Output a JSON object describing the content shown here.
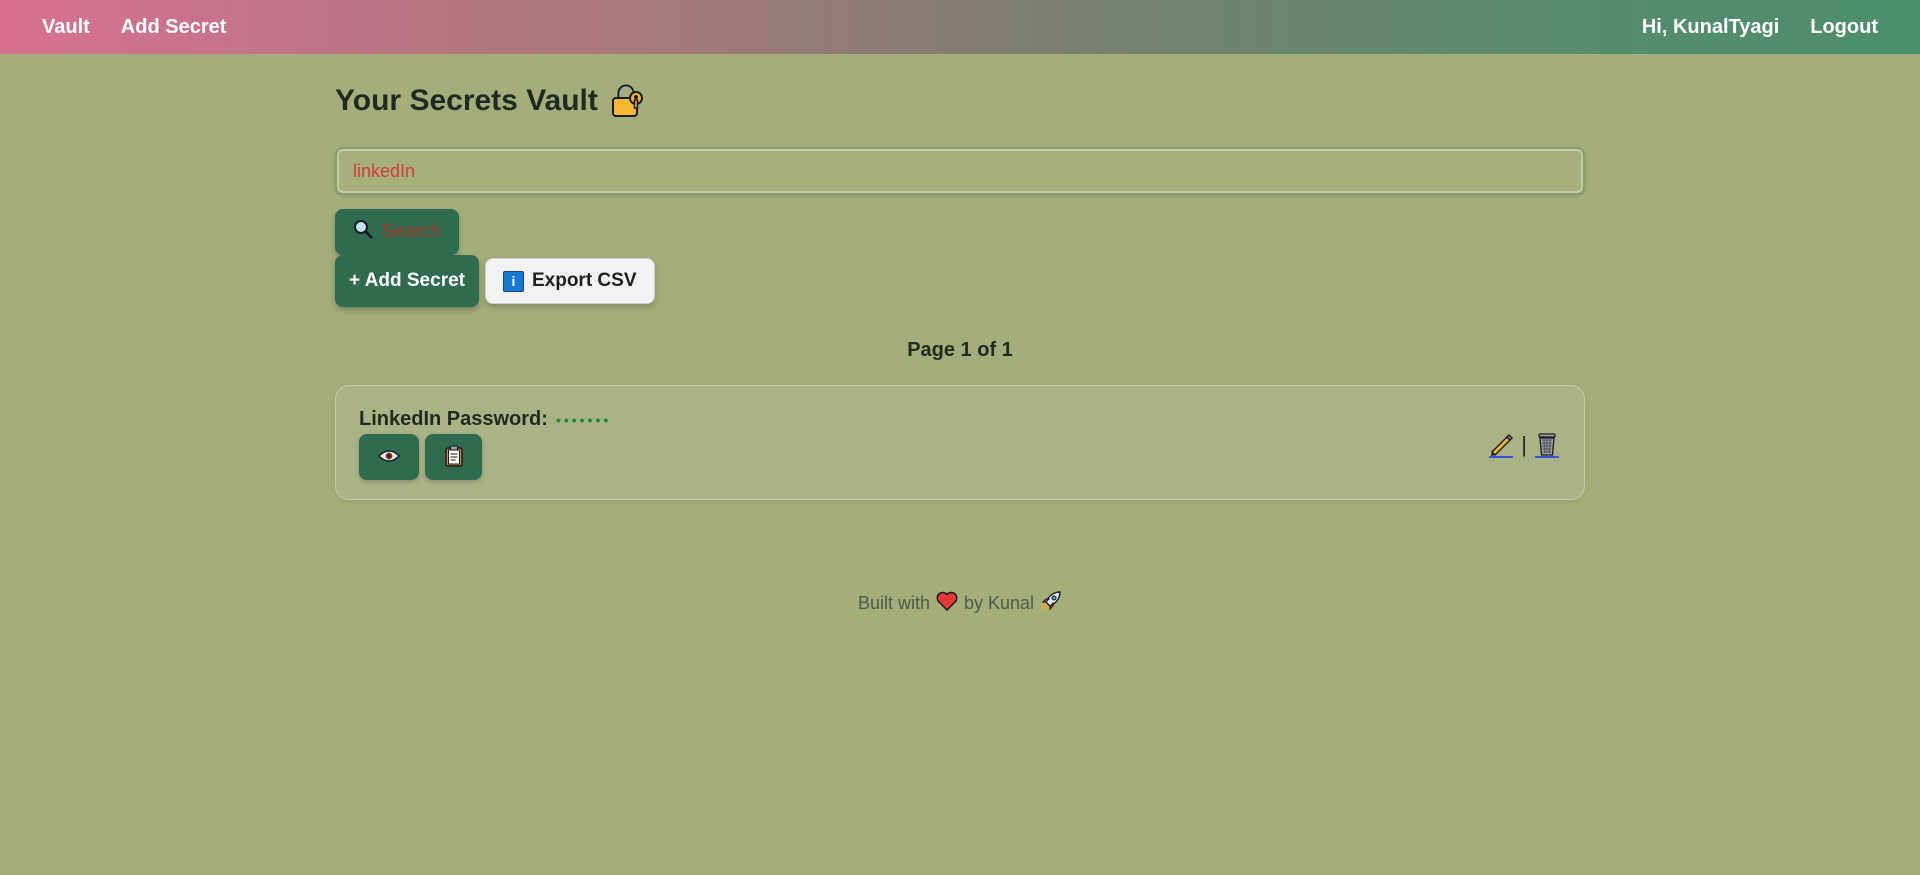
{
  "nav": {
    "brand": "Vault",
    "add_secret": "Add Secret",
    "greeting": "Hi, KunalTyagi",
    "logout": "Logout"
  },
  "page": {
    "title": "Your Secrets Vault",
    "title_icon": "lock-icon"
  },
  "search": {
    "value": "linkedIn",
    "button_label": "Search",
    "button_icon": "magnifier-icon"
  },
  "actions": {
    "add_secret_label": "+ Add Secret",
    "export_label": "Export CSV",
    "export_icon": "info-icon"
  },
  "pagination": {
    "label": "Page 1 of 1"
  },
  "secrets": [
    {
      "label": "LinkedIn Password",
      "masked": "•••••••",
      "view_icon": "eye-icon",
      "copy_icon": "clipboard-icon",
      "edit_icon": "pencil-icon",
      "delete_icon": "trash-icon"
    }
  ],
  "footer": {
    "prefix": "Built with",
    "suffix": "by Kunal"
  },
  "colors": {
    "background": "#a3ae7a",
    "button_green": "#2f6b4f",
    "search_text": "#d33a3a",
    "masked_dots": "#1f8a3a"
  }
}
